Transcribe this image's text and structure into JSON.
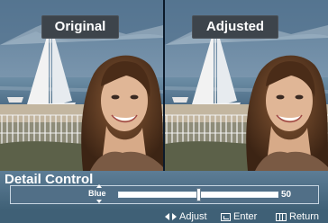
{
  "preview": {
    "left_label": "Original",
    "right_label": "Adjusted"
  },
  "menu": {
    "title": "Detail Control",
    "setting": {
      "name": "Blue",
      "value": "50",
      "level_fraction": 0.5
    }
  },
  "help": {
    "adjust": "Adjust",
    "enter": "Enter",
    "return": "Return"
  },
  "icons": [
    "left-right-arrows-icon",
    "enter-icon",
    "return-menu-icon"
  ]
}
